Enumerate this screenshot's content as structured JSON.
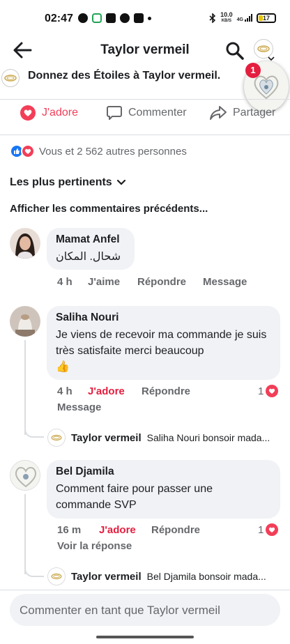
{
  "status_bar": {
    "time": "02:47",
    "net_speed_top": "10.0",
    "net_speed_bottom": "KB/S",
    "network": "4G",
    "battery": "17"
  },
  "header": {
    "title": "Taylor vermeil"
  },
  "stars_prompt": "Donnez des Étoiles à Taylor vermeil.",
  "chat_head_badge": "1",
  "actions": {
    "like": "J'adore",
    "comment": "Commenter",
    "share": "Partager"
  },
  "reactions_summary": "Vous et 2 562 autres personnes",
  "sort_label": "Les plus pertinents",
  "show_previous": "Afficher les commentaires précédents...",
  "comments": [
    {
      "name": "Mamat Anfel",
      "text": "شحال. المكان",
      "time": "4 h",
      "reaction": "J'aime",
      "reply": "Répondre",
      "message": "Message"
    },
    {
      "name": "Saliha Nouri",
      "text": "Je viens de recevoir ma commande je suis très satisfaite merci beaucoup",
      "emoji": "👍",
      "time": "4 h",
      "reaction": "J'adore",
      "reply": "Répondre",
      "count": "1",
      "message": "Message",
      "reply_preview": {
        "name": "Taylor vermeil",
        "text": "Saliha Nouri bonsoir mada..."
      }
    },
    {
      "name": "Bel Djamila",
      "text": "Comment faire pour passer une commande SVP",
      "time": "16 m",
      "reaction": "J'adore",
      "reply": "Répondre",
      "count": "1",
      "see_reply": "Voir la réponse",
      "reply_preview": {
        "name": "Taylor vermeil",
        "text": "Bel Djamila bonsoir mada..."
      }
    }
  ],
  "composer_placeholder": "Commenter en tant que Taylor vermeil",
  "colors": {
    "love": "#f33e58",
    "like_blue": "#1877f2",
    "muted": "#65676b",
    "bubble": "#f0f2f5"
  }
}
